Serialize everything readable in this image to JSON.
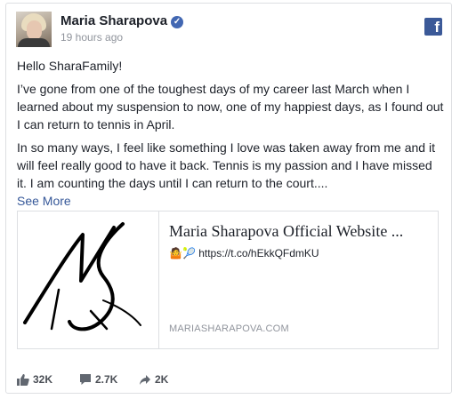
{
  "post": {
    "author": "Maria Sharapova",
    "verified_icon": "verified-check-icon",
    "timestamp": "19 hours ago",
    "platform_icon": "facebook-icon",
    "paragraphs": [
      "Hello SharaFamily!",
      "I’ve gone from one of the toughest days of my career last March when I learned about my suspension to now, one of my happiest days, as I found out I can return to tennis in April.",
      "In so many ways, I feel like something I love was taken away from me and it will feel really good to have it back. Tennis is my passion and I have missed it. I am counting the days until I can return to the court...."
    ],
    "see_more": "See More"
  },
  "link_card": {
    "image_icon": "ms-monogram-logo",
    "title": "Maria Sharapova Official Website ...",
    "description": "🤷🎾 https://t.co/hEkkQFdmKU",
    "domain": "MARIASHARAPOVA.COM"
  },
  "stats": {
    "likes": "32K",
    "comments": "2.7K",
    "shares": "2K"
  },
  "colors": {
    "facebook_blue": "#3b5998",
    "link": "#365899",
    "text": "#1d2129",
    "muted": "#90949c"
  }
}
